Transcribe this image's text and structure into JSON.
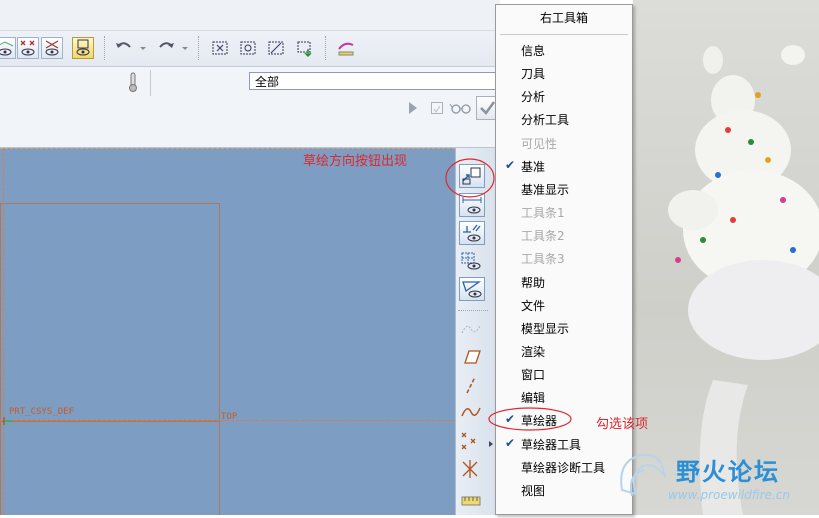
{
  "toolbar": {
    "undo_icon": "undo-icon",
    "redo_icon": "redo-icon"
  },
  "filter": {
    "value": "全部"
  },
  "canvas": {
    "csys_label": "PRT_CSYS_DEF",
    "top_label": "TOP"
  },
  "menu": {
    "title": "右工具箱",
    "items": [
      {
        "label": "信息",
        "checked": false,
        "enabled": true
      },
      {
        "label": "刀具",
        "checked": false,
        "enabled": true
      },
      {
        "label": "分析",
        "checked": false,
        "enabled": true
      },
      {
        "label": "分析工具",
        "checked": false,
        "enabled": true
      },
      {
        "label": "可见性",
        "checked": false,
        "enabled": false
      },
      {
        "label": "基准",
        "checked": true,
        "enabled": true
      },
      {
        "label": "基准显示",
        "checked": false,
        "enabled": true
      },
      {
        "label": "工具条1",
        "checked": false,
        "enabled": false
      },
      {
        "label": "工具条2",
        "checked": false,
        "enabled": false
      },
      {
        "label": "工具条3",
        "checked": false,
        "enabled": false
      },
      {
        "label": "帮助",
        "checked": false,
        "enabled": true
      },
      {
        "label": "文件",
        "checked": false,
        "enabled": true
      },
      {
        "label": "模型显示",
        "checked": false,
        "enabled": true
      },
      {
        "label": "渲染",
        "checked": false,
        "enabled": true
      },
      {
        "label": "窗口",
        "checked": false,
        "enabled": true
      },
      {
        "label": "编辑",
        "checked": false,
        "enabled": true
      },
      {
        "label": "草绘器",
        "checked": true,
        "enabled": true
      },
      {
        "label": "草绘器工具",
        "checked": true,
        "enabled": true
      },
      {
        "label": "草绘器诊断工具",
        "checked": false,
        "enabled": true
      },
      {
        "label": "视图",
        "checked": false,
        "enabled": true
      }
    ]
  },
  "annotations": {
    "sketch_orientation_note": "草绘方向按钮出现",
    "check_option_note": "勾选该项"
  },
  "watermark": {
    "site_name": "野火论坛",
    "url": "www.proewildfire.cn"
  },
  "colors": {
    "annotation_red": "#e0262b",
    "canvas_blue": "#7d9dc2",
    "check_blue": "#1d4e9a"
  }
}
